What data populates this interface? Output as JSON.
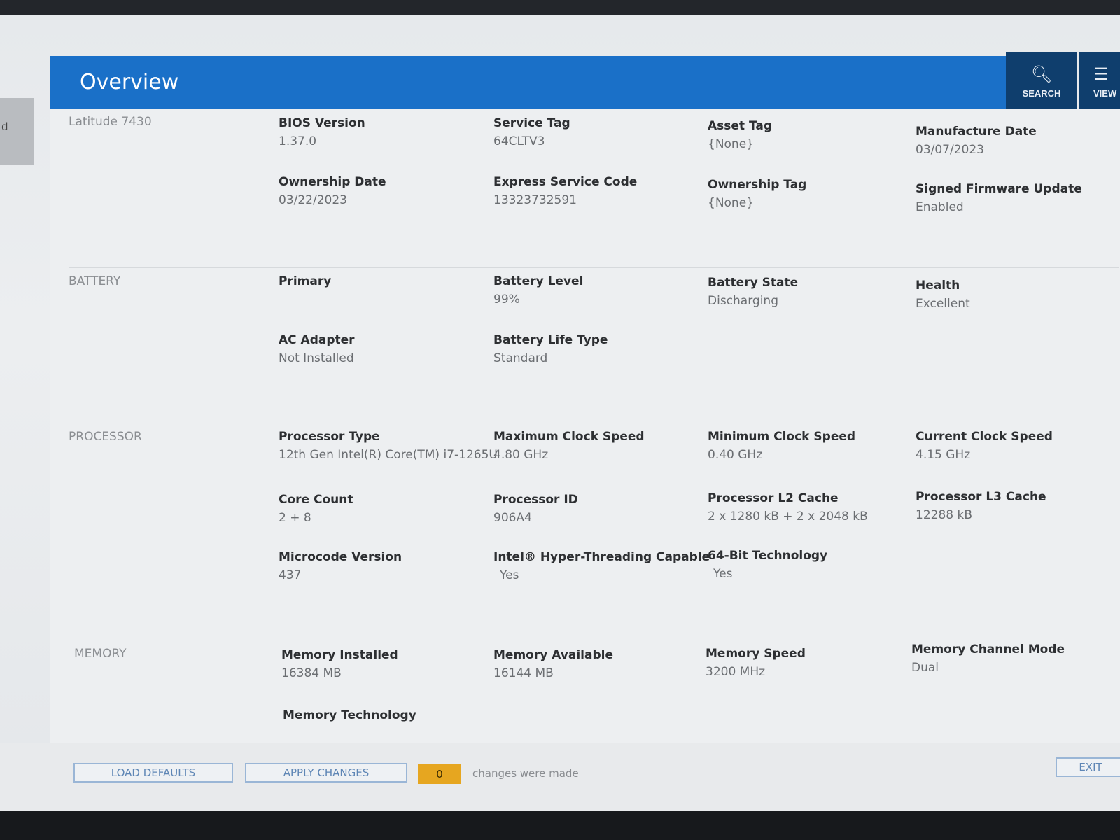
{
  "sidebar": {
    "tab_label": "d"
  },
  "header": {
    "title": "Overview"
  },
  "toolbar": {
    "search_label": "SEARCH",
    "view_label": "VIEW"
  },
  "system": {
    "label": "Latitude 7430",
    "fields": [
      {
        "label": "BIOS Version",
        "value": "1.37.0"
      },
      {
        "label": "Service Tag",
        "value": "64CLTV3"
      },
      {
        "label": "Asset Tag",
        "value": "{None}"
      },
      {
        "label": "Manufacture Date",
        "value": "03/07/2023"
      },
      {
        "label": "Ownership Date",
        "value": "03/22/2023"
      },
      {
        "label": "Express Service Code",
        "value": "13323732591"
      },
      {
        "label": "Ownership Tag",
        "value": "{None}"
      },
      {
        "label": "Signed Firmware Update",
        "value": "Enabled"
      }
    ]
  },
  "battery": {
    "label": "BATTERY",
    "fields": [
      {
        "label": "Primary",
        "value": ""
      },
      {
        "label": "Battery Level",
        "value": "99%"
      },
      {
        "label": "Battery State",
        "value": "Discharging"
      },
      {
        "label": "Health",
        "value": "Excellent"
      },
      {
        "label": "AC Adapter",
        "value": "Not Installed"
      },
      {
        "label": "Battery Life Type",
        "value": "Standard"
      }
    ]
  },
  "processor": {
    "label": "PROCESSOR",
    "fields": [
      {
        "label": "Processor Type",
        "value": "12th Gen Intel(R) Core(TM) i7-1265U"
      },
      {
        "label": "Maximum Clock Speed",
        "value": "4.80 GHz"
      },
      {
        "label": "Minimum Clock Speed",
        "value": "0.40 GHz"
      },
      {
        "label": "Current Clock Speed",
        "value": "4.15 GHz"
      },
      {
        "label": "Core Count",
        "value": "2 + 8"
      },
      {
        "label": "Processor ID",
        "value": "906A4"
      },
      {
        "label": "Processor L2 Cache",
        "value": "2 x 1280  kB + 2 x 2048  kB"
      },
      {
        "label": "Processor L3 Cache",
        "value": "12288 kB"
      },
      {
        "label": "Microcode Version",
        "value": "437"
      },
      {
        "label": "Intel® Hyper-Threading Capable",
        "value": "Yes"
      },
      {
        "label": "64-Bit Technology",
        "value": "Yes"
      }
    ]
  },
  "memory": {
    "label": "MEMORY",
    "fields": [
      {
        "label": "Memory Installed",
        "value": "16384 MB"
      },
      {
        "label": "Memory Available",
        "value": "16144 MB"
      },
      {
        "label": "Memory Speed",
        "value": "3200 MHz"
      },
      {
        "label": "Memory Channel Mode",
        "value": "Dual"
      },
      {
        "label": "Memory Technology",
        "value": ""
      }
    ]
  },
  "footer": {
    "load_defaults_label": "LOAD DEFAULTS",
    "apply_changes_label": "APPLY CHANGES",
    "changes_count": "0",
    "changes_text": "changes were made",
    "exit_label": "EXIT"
  },
  "colors": {
    "header_blue": "#1a70c8",
    "toolbar_navy": "#0f3e6d",
    "badge_amber": "#e6a620"
  }
}
